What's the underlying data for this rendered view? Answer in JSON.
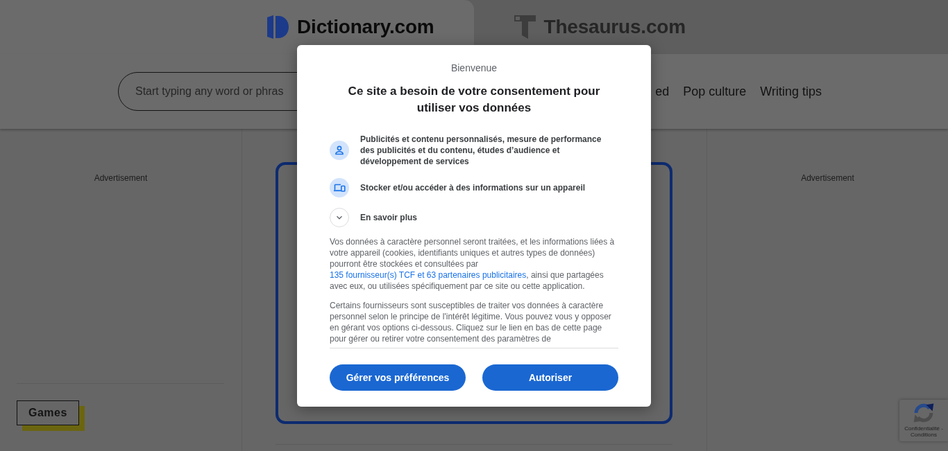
{
  "site_tabs": [
    {
      "label": "Dictionary.com",
      "selected": true
    },
    {
      "label": "Thesaurus.com",
      "selected": false
    }
  ],
  "search": {
    "placeholder": "Start typing any word or phras"
  },
  "nav_links": [
    "ed",
    "Pop culture",
    "Writing tips"
  ],
  "left_column": {
    "ad_label": "Advertisement",
    "games_button": "Games"
  },
  "right_column": {
    "ad_label": "Advertisement"
  },
  "consent_dialog": {
    "eyebrow": "Bienvenue",
    "title": "Ce site a besoin de votre consentement pour utiliser vos données",
    "purposes": [
      {
        "kind": "ads",
        "label": "Publicités et contenu personnalisés, mesure de performance des publicités et du contenu, études d’audience et développement de services"
      },
      {
        "kind": "storage",
        "label": "Stocker et/ou accéder à des informations sur un appareil"
      }
    ],
    "learn_more": {
      "label": "En savoir plus",
      "expanded": false
    },
    "notice": {
      "before": "Vos données à caractère personnel seront traitées, et les informations liées à votre appareil (cookies, identifiants uniques et autres types de données) pourront être stockées et consultées par ",
      "link": "135 fournisseur(s) TCF et 63 partenaires publicitaires",
      "after": ", ainsi que partagées avec eux, ou utilisées spécifiquement par ce site ou cette application."
    },
    "legitimate_interest": "Certains fournisseurs sont susceptibles de traiter vos données à caractère personnel selon le principe de l'intérêt légitime. Vous pouvez vous y opposer en gérant vos options ci-dessous. Cliquez sur le lien en bas de cette page pour gérer ou retirer votre consentement des paramètres de",
    "buttons": [
      "Gérer vos préférences",
      "Autoriser"
    ]
  },
  "captcha_badge": {
    "text": "Confidentialité - Conditions"
  }
}
